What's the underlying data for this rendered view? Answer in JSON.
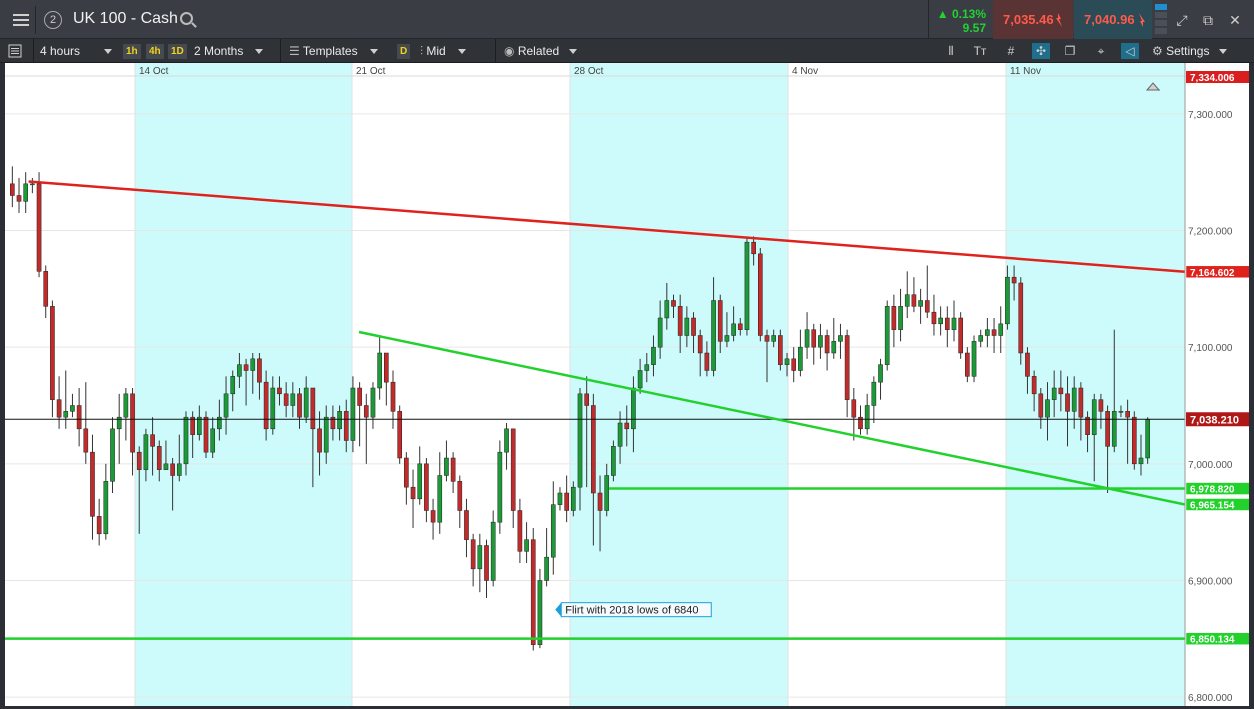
{
  "header": {
    "instrument_number": "2",
    "title": "UK 100 - Cash",
    "change_pct": "0.13%",
    "change_pts": "9.57",
    "sell_price": "7,035.46",
    "buy_price": "7,040.96"
  },
  "toolbar": {
    "interval": "4 hours",
    "tf_1h": "1h",
    "tf_4h": "4h",
    "tf_1d": "1D",
    "range": "2 Months",
    "templates": "Templates",
    "d_badge": "D",
    "price_type": "Mid",
    "related": "Related",
    "settings": "Settings"
  },
  "colors": {
    "trend_red": "#e0221c",
    "trend_green": "#22d12c",
    "candle_up": "#1d9a38",
    "candle_down": "#c22b2b",
    "highlight_band": "#cdfbfb",
    "current_price_label": "#b01818"
  },
  "chart_data": {
    "type": "candlestick",
    "instrument": "UK 100 - Cash",
    "timeframe": "4 hours",
    "x_tick_labels": [
      "14 Oct",
      "21 Oct",
      "28 Oct",
      "4 Nov",
      "11 Nov"
    ],
    "y_ticks": [
      6800,
      6900,
      7000,
      7100,
      7200,
      7300
    ],
    "y_tick_labels": [
      "6,800.000",
      "6,900.000",
      "7,000.000",
      "7,100.000",
      "7,200.000",
      "7,300.000"
    ],
    "ylim": [
      6795,
      7335
    ],
    "grid": true,
    "candles": [
      [
        7240,
        7230,
        7255,
        7220
      ],
      [
        7230,
        7225,
        7245,
        7215
      ],
      [
        7225,
        7240,
        7250,
        7215
      ],
      [
        7240,
        7240,
        7245,
        7232
      ],
      [
        7240,
        7165,
        7250,
        7160
      ],
      [
        7165,
        7135,
        7170,
        7125
      ],
      [
        7135,
        7055,
        7140,
        7040
      ],
      [
        7055,
        7040,
        7075,
        7030
      ],
      [
        7040,
        7045,
        7080,
        7030
      ],
      [
        7045,
        7050,
        7060,
        7040
      ],
      [
        7050,
        7030,
        7065,
        7015
      ],
      [
        7030,
        7010,
        7070,
        7000
      ],
      [
        7010,
        6955,
        7025,
        6935
      ],
      [
        6955,
        6940,
        6970,
        6930
      ],
      [
        6940,
        6985,
        7000,
        6935
      ],
      [
        6985,
        7030,
        7040,
        6975
      ],
      [
        7030,
        7040,
        7060,
        7000
      ],
      [
        7040,
        7060,
        7065,
        7020
      ],
      [
        7060,
        7010,
        7065,
        6990
      ],
      [
        7010,
        6995,
        7015,
        6940
      ],
      [
        6995,
        7025,
        7030,
        6985
      ],
      [
        7025,
        7015,
        7040,
        6990
      ],
      [
        7015,
        6995,
        7020,
        6985
      ],
      [
        6995,
        7000,
        7020,
        6995
      ],
      [
        7000,
        6990,
        7005,
        6960
      ],
      [
        6990,
        7000,
        7025,
        6985
      ],
      [
        7000,
        7040,
        7045,
        6990
      ],
      [
        7040,
        7025,
        7045,
        7005
      ],
      [
        7025,
        7040,
        7050,
        7020
      ],
      [
        7040,
        7010,
        7045,
        7005
      ],
      [
        7010,
        7030,
        7040,
        7005
      ],
      [
        7030,
        7040,
        7055,
        7020
      ],
      [
        7040,
        7060,
        7075,
        7025
      ],
      [
        7060,
        7075,
        7080,
        7045
      ],
      [
        7075,
        7085,
        7095,
        7065
      ],
      [
        7085,
        7080,
        7090,
        7050
      ],
      [
        7080,
        7090,
        7095,
        7060
      ],
      [
        7090,
        7070,
        7095,
        7055
      ],
      [
        7070,
        7030,
        7080,
        7020
      ],
      [
        7030,
        7065,
        7075,
        7025
      ],
      [
        7065,
        7060,
        7075,
        7050
      ],
      [
        7060,
        7050,
        7070,
        7040
      ],
      [
        7050,
        7060,
        7070,
        7040
      ],
      [
        7060,
        7040,
        7065,
        7030
      ],
      [
        7040,
        7065,
        7075,
        7035
      ],
      [
        7065,
        7030,
        7065,
        6980
      ],
      [
        7030,
        7010,
        7045,
        6990
      ],
      [
        7010,
        7040,
        7050,
        7000
      ],
      [
        7040,
        7030,
        7050,
        7020
      ],
      [
        7030,
        7045,
        7050,
        7020
      ],
      [
        7045,
        7020,
        7055,
        7010
      ],
      [
        7020,
        7065,
        7075,
        7010
      ],
      [
        7065,
        7050,
        7070,
        7015
      ],
      [
        7050,
        7040,
        7060,
        7000
      ],
      [
        7040,
        7065,
        7070,
        7030
      ],
      [
        7065,
        7095,
        7110,
        7055
      ],
      [
        7095,
        7070,
        7095,
        7050
      ],
      [
        7070,
        7045,
        7080,
        7030
      ],
      [
        7045,
        7005,
        7050,
        7000
      ],
      [
        7005,
        6980,
        7010,
        6965
      ],
      [
        6980,
        6970,
        6995,
        6945
      ],
      [
        6970,
        7000,
        7015,
        6965
      ],
      [
        7000,
        6960,
        7005,
        6950
      ],
      [
        6960,
        6950,
        6970,
        6935
      ],
      [
        6950,
        6990,
        7010,
        6940
      ],
      [
        6990,
        7005,
        7020,
        6985
      ],
      [
        7005,
        6985,
        7010,
        6975
      ],
      [
        6985,
        6960,
        6990,
        6945
      ],
      [
        6960,
        6935,
        6970,
        6920
      ],
      [
        6935,
        6910,
        6940,
        6895
      ],
      [
        6910,
        6930,
        6940,
        6890
      ],
      [
        6930,
        6900,
        6935,
        6885
      ],
      [
        6900,
        6950,
        6960,
        6895
      ],
      [
        6950,
        7010,
        7020,
        6940
      ],
      [
        7010,
        7030,
        7035,
        6995
      ],
      [
        7030,
        6960,
        7030,
        6945
      ],
      [
        6960,
        6925,
        6970,
        6915
      ],
      [
        6925,
        6935,
        6950,
        6915
      ],
      [
        6935,
        6845,
        6945,
        6840
      ],
      [
        6845,
        6900,
        6910,
        6842
      ],
      [
        6900,
        6920,
        6945,
        6895
      ],
      [
        6920,
        6965,
        6985,
        6905
      ],
      [
        6965,
        6975,
        6980,
        6960
      ],
      [
        6975,
        6960,
        6990,
        6950
      ],
      [
        6960,
        6980,
        6985,
        6955
      ],
      [
        6980,
        7060,
        7065,
        6960
      ],
      [
        7060,
        7050,
        7075,
        6980
      ],
      [
        7050,
        6975,
        7060,
        6930
      ],
      [
        6975,
        6960,
        6990,
        6925
      ],
      [
        6960,
        6990,
        7000,
        6955
      ],
      [
        6990,
        7015,
        7020,
        6985
      ],
      [
        7015,
        7035,
        7045,
        7000
      ],
      [
        7035,
        7030,
        7050,
        7015
      ],
      [
        7030,
        7065,
        7075,
        7010
      ],
      [
        7065,
        7080,
        7090,
        7060
      ],
      [
        7080,
        7085,
        7095,
        7070
      ],
      [
        7085,
        7100,
        7110,
        7075
      ],
      [
        7100,
        7125,
        7140,
        7090
      ],
      [
        7125,
        7140,
        7155,
        7115
      ],
      [
        7140,
        7135,
        7145,
        7125
      ],
      [
        7135,
        7110,
        7145,
        7095
      ],
      [
        7110,
        7125,
        7135,
        7100
      ],
      [
        7125,
        7110,
        7130,
        7095
      ],
      [
        7110,
        7095,
        7115,
        7075
      ],
      [
        7095,
        7080,
        7105,
        7075
      ],
      [
        7080,
        7140,
        7160,
        7075
      ],
      [
        7140,
        7105,
        7145,
        7095
      ],
      [
        7105,
        7110,
        7130,
        7100
      ],
      [
        7110,
        7120,
        7135,
        7105
      ],
      [
        7120,
        7115,
        7125,
        7110
      ],
      [
        7115,
        7190,
        7195,
        7110
      ],
      [
        7190,
        7180,
        7195,
        7170
      ],
      [
        7180,
        7110,
        7185,
        7105
      ],
      [
        7110,
        7105,
        7115,
        7070
      ],
      [
        7105,
        7110,
        7115,
        7100
      ],
      [
        7110,
        7085,
        7115,
        7080
      ],
      [
        7085,
        7090,
        7095,
        7075
      ],
      [
        7090,
        7080,
        7100,
        7070
      ],
      [
        7080,
        7100,
        7115,
        7075
      ],
      [
        7100,
        7115,
        7130,
        7090
      ],
      [
        7115,
        7100,
        7120,
        7085
      ],
      [
        7100,
        7110,
        7120,
        7090
      ],
      [
        7110,
        7095,
        7115,
        7080
      ],
      [
        7095,
        7105,
        7125,
        7090
      ],
      [
        7105,
        7110,
        7120,
        7090
      ],
      [
        7110,
        7055,
        7115,
        7040
      ],
      [
        7055,
        7040,
        7065,
        7020
      ],
      [
        7040,
        7030,
        7050,
        7025
      ],
      [
        7030,
        7050,
        7060,
        7025
      ],
      [
        7050,
        7070,
        7075,
        7035
      ],
      [
        7070,
        7085,
        7090,
        7055
      ],
      [
        7085,
        7135,
        7140,
        7080
      ],
      [
        7135,
        7115,
        7145,
        7100
      ],
      [
        7115,
        7135,
        7150,
        7105
      ],
      [
        7135,
        7145,
        7165,
        7125
      ],
      [
        7145,
        7135,
        7160,
        7130
      ],
      [
        7135,
        7140,
        7150,
        7120
      ],
      [
        7140,
        7130,
        7170,
        7125
      ],
      [
        7130,
        7120,
        7145,
        7110
      ],
      [
        7120,
        7125,
        7135,
        7110
      ],
      [
        7125,
        7115,
        7135,
        7100
      ],
      [
        7115,
        7125,
        7140,
        7105
      ],
      [
        7125,
        7095,
        7130,
        7090
      ],
      [
        7095,
        7075,
        7100,
        7070
      ],
      [
        7075,
        7105,
        7110,
        7070
      ],
      [
        7105,
        7110,
        7115,
        7100
      ],
      [
        7110,
        7115,
        7125,
        7100
      ],
      [
        7115,
        7110,
        7125,
        7095
      ],
      [
        7110,
        7120,
        7135,
        7095
      ],
      [
        7120,
        7160,
        7170,
        7115
      ],
      [
        7160,
        7155,
        7170,
        7140
      ],
      [
        7155,
        7095,
        7160,
        7085
      ],
      [
        7095,
        7075,
        7100,
        7060
      ],
      [
        7075,
        7060,
        7080,
        7045
      ],
      [
        7060,
        7040,
        7065,
        7030
      ],
      [
        7040,
        7055,
        7070,
        7020
      ],
      [
        7055,
        7065,
        7080,
        7040
      ],
      [
        7065,
        7060,
        7080,
        7045
      ],
      [
        7060,
        7045,
        7075,
        7015
      ],
      [
        7045,
        7065,
        7075,
        7030
      ],
      [
        7065,
        7040,
        7070,
        7020
      ],
      [
        7040,
        7025,
        7045,
        7010
      ],
      [
        7025,
        7055,
        7060,
        6985
      ],
      [
        7055,
        7045,
        7060,
        7030
      ],
      [
        7045,
        7015,
        7050,
        6975
      ],
      [
        7015,
        7045,
        7115,
        7010
      ],
      [
        7045,
        7045,
        7050,
        7040
      ],
      [
        7045,
        7040,
        7055,
        7000
      ],
      [
        7040,
        7000,
        7045,
        6995
      ],
      [
        7000,
        7005,
        7025,
        6990
      ],
      [
        7005,
        7038,
        7040,
        7000
      ]
    ],
    "trend_lines": [
      {
        "color": "red",
        "from": [
          0.02,
          7242
        ],
        "to": [
          1.0,
          7164.602
        ],
        "label": "7,164.602"
      },
      {
        "color": "green",
        "from": [
          0.3,
          7113
        ],
        "to": [
          1.0,
          6965.154
        ],
        "label": "6,965.154"
      },
      {
        "color": "green",
        "from": [
          0.512,
          6978.82
        ],
        "to": [
          1.0,
          6978.82
        ],
        "label": "6,978.820"
      },
      {
        "color": "green",
        "from": [
          0.0,
          6850.134
        ],
        "to": [
          1.0,
          6850.134
        ],
        "label": "6,850.134"
      }
    ],
    "current_price": 7038.21,
    "current_price_label": "7,038.210",
    "top_price_label": "7,334.006",
    "annotation": {
      "text": "Flirt with 2018 lows of 6840",
      "at_candle": 78,
      "value": 6840
    }
  }
}
